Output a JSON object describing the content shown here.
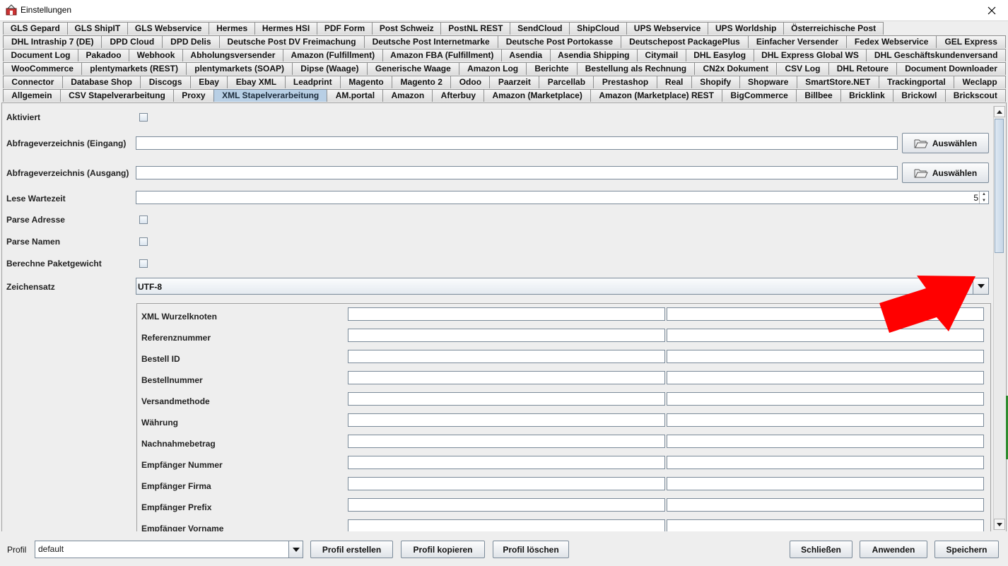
{
  "window": {
    "title": "Einstellungen"
  },
  "tabs": {
    "rows": [
      [
        "GLS Gepard",
        "GLS ShipIT",
        "GLS Webservice",
        "Hermes",
        "Hermes HSI",
        "PDF Form",
        "Post Schweiz",
        "PostNL REST",
        "SendCloud",
        "ShipCloud",
        "UPS Webservice",
        "UPS Worldship",
        "Österreichische Post"
      ],
      [
        "DHL Intraship 7 (DE)",
        "DPD Cloud",
        "DPD Delis",
        "Deutsche Post DV Freimachung",
        "Deutsche Post Internetmarke",
        "Deutsche Post Portokasse",
        "Deutschepost PackagePlus",
        "Einfacher Versender",
        "Fedex Webservice",
        "GEL Express"
      ],
      [
        "Document Log",
        "Pakadoo",
        "Webhook",
        "Abholungsversender",
        "Amazon (Fulfillment)",
        "Amazon FBA (Fulfillment)",
        "Asendia",
        "Asendia Shipping",
        "Citymail",
        "DHL Easylog",
        "DHL Express Global WS",
        "DHL Geschäftskundenversand"
      ],
      [
        "WooCommerce",
        "plentymarkets (REST)",
        "plentymarkets (SOAP)",
        "Dipse (Waage)",
        "Generische Waage",
        "Amazon Log",
        "Berichte",
        "Bestellung als Rechnung",
        "CN2x Dokument",
        "CSV Log",
        "DHL Retoure",
        "Document Downloader"
      ],
      [
        "Connector",
        "Database Shop",
        "Discogs",
        "Ebay",
        "Ebay XML",
        "Leadprint",
        "Magento",
        "Magento 2",
        "Odoo",
        "Paarzeit",
        "Parcellab",
        "Prestashop",
        "Real",
        "Shopify",
        "Shopware",
        "SmartStore.NET",
        "Trackingportal",
        "Weclapp"
      ],
      [
        "Allgemein",
        "CSV Stapelverarbeitung",
        "Proxy",
        "XML Stapelverarbeitung",
        "AM.portal",
        "Amazon",
        "Afterbuy",
        "Amazon (Marketplace)",
        "Amazon (Marketplace) REST",
        "BigCommerce",
        "Billbee",
        "Bricklink",
        "Brickowl",
        "Brickscout"
      ]
    ],
    "active": "XML Stapelverarbeitung"
  },
  "form": {
    "aktiviert_label": "Aktiviert",
    "eingang_label": "Abfrageverzeichnis (Eingang)",
    "eingang_value": "",
    "ausgang_label": "Abfrageverzeichnis (Ausgang)",
    "ausgang_value": "",
    "choose_label": "Auswählen",
    "lese_label": "Lese Wartezeit",
    "lese_value": "5",
    "parse_adresse_label": "Parse Adresse",
    "parse_namen_label": "Parse Namen",
    "paketgewicht_label": "Berechne Paketgewicht",
    "zeichensatz_label": "Zeichensatz",
    "zeichensatz_value": "UTF-8"
  },
  "mapping": {
    "rows": [
      "XML Wurzelknoten",
      "Referenznummer",
      "Bestell ID",
      "Bestellnummer",
      "Versandmethode",
      "Währung",
      "Nachnahmebetrag",
      "Empfänger Nummer",
      "Empfänger Firma",
      "Empfänger Prefix",
      "Empfänger Vorname"
    ]
  },
  "footer": {
    "profil_label": "Profil",
    "profil_value": "default",
    "create_label": "Profil erstellen",
    "copy_label": "Profil kopieren",
    "delete_label": "Profil löschen",
    "close_label": "Schließen",
    "apply_label": "Anwenden",
    "save_label": "Speichern"
  },
  "colors": {
    "annotation_arrow": "#ff0000",
    "active_tab": "#b8cfe5"
  }
}
